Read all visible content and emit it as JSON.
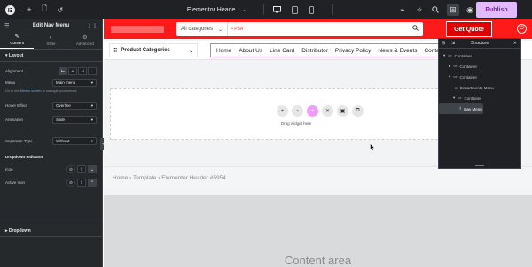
{
  "topbar": {
    "page_title": "Elementor Heade...",
    "publish_label": "Publish"
  },
  "panel": {
    "title": "Edit Nav Menu",
    "tabs": [
      {
        "label": "Content",
        "active": true
      },
      {
        "label": "Style",
        "active": false
      },
      {
        "label": "Advanced",
        "active": false
      }
    ],
    "layout_title": "Layout",
    "alignment_label": "Alignment",
    "menu_label": "Menu",
    "menu_value": "Main menu",
    "menu_note_pre": "Go to the ",
    "menu_note_link": "Menus screen",
    "menu_note_post": " to manage your menus.",
    "hover_effect_label": "Hover Effect",
    "hover_effect_value": "Overline",
    "animation_label": "Animation",
    "animation_value": "Slide",
    "separator_label": "Separator Type",
    "separator_value": "Without",
    "dropdown_indicator_title": "Dropdown Indicator",
    "icon_label": "Icon",
    "active_icon_label": "Active Icon",
    "dropdown_section": "Dropdown"
  },
  "site": {
    "search_category": "All categories",
    "search_placeholder": "PSA",
    "quote_label": "Get Quote",
    "product_categories": "Product Categories",
    "menu_items": [
      "Home",
      "About Us",
      "Line Card",
      "Distributor",
      "Privacy Policy",
      "News & Events",
      "Conta"
    ],
    "drag_text": "Drag widget here",
    "breadcrumb": [
      "Home",
      "Template",
      "Elementor Header #5954"
    ],
    "content_area": "Content area"
  },
  "structure": {
    "title": "Structure",
    "items": [
      {
        "label": "Container",
        "depth": 0,
        "arrow": "▾"
      },
      {
        "label": "Container",
        "depth": 1,
        "arrow": "▸"
      },
      {
        "label": "Container",
        "depth": 1,
        "arrow": "▾"
      },
      {
        "label": "Departments Menu",
        "depth": 2,
        "arrow": ""
      },
      {
        "label": "Container",
        "depth": 2,
        "arrow": "▾"
      },
      {
        "label": "Nav Menu",
        "depth": 3,
        "arrow": "",
        "selected": true
      }
    ]
  },
  "colors": {
    "header_red": "#ff1a1a",
    "publish_bg": "#e3b9ff",
    "panel_bg": "#26292c"
  }
}
